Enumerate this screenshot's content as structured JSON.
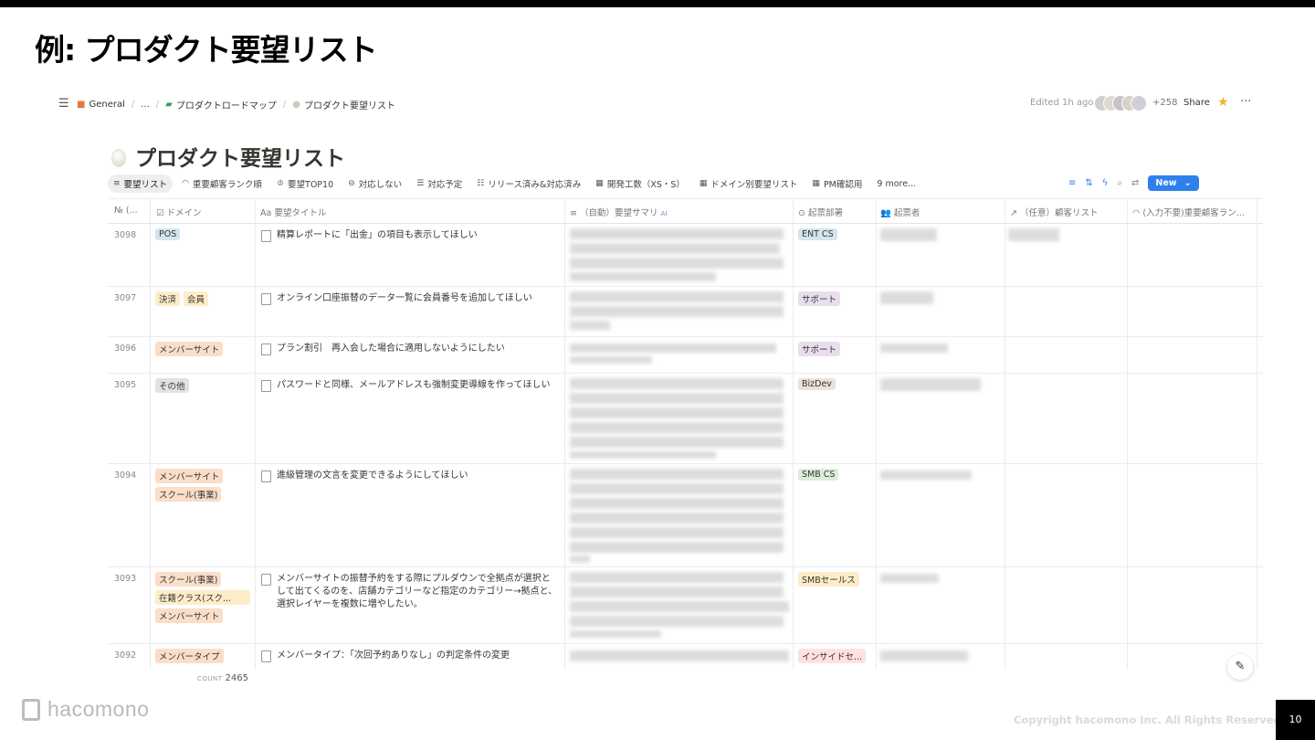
{
  "slide": {
    "title": "例: プロダクト要望リスト",
    "copyright": "Copyright hacomono Inc. All Rights Reserved.",
    "page_number": "10",
    "logo_text": "hacomono"
  },
  "header": {
    "breadcrumbs": [
      "General",
      "...",
      "プロダクトロードマップ",
      "プロダクト要望リスト"
    ],
    "edited": "Edited 1h ago",
    "member_count": "+258",
    "share": "Share"
  },
  "page_title": "プロダクト要望リスト",
  "views": [
    "要望リスト",
    "重要顧客ランク順",
    "要望TOP10",
    "対応しない",
    "対応予定",
    "リリース済み&対応済み",
    "開発工数（XS・S）",
    "ドメイン別要望リスト",
    "PM確認用",
    "9 more..."
  ],
  "new_button": "New",
  "columns": [
    "№ (...",
    "ドメイン",
    "要望タイトル",
    "（自動）要望サマリ",
    "起票部署",
    "起票者",
    "（任意）顧客リスト",
    "(入力不要)重要顧客ラン..."
  ],
  "ai_badge": "AI",
  "rows": [
    {
      "id": "3098",
      "domains": [
        "POS"
      ],
      "title": "精算レポートに「出金」の項目も表示してほしい",
      "dept": "ENT CS"
    },
    {
      "id": "3097",
      "domains": [
        "決済",
        "会員"
      ],
      "title": "オンライン口座振替のデータ一覧に会員番号を追加してほしい",
      "dept": "サポート"
    },
    {
      "id": "3096",
      "domains": [
        "メンバーサイト"
      ],
      "title": "プラン割引　再入会した場合に適用しないようにしたい",
      "dept": "サポート"
    },
    {
      "id": "3095",
      "domains": [
        "その他"
      ],
      "title": "パスワードと同様、メールアドレスも強制変更導線を作ってほしい",
      "dept": "BizDev"
    },
    {
      "id": "3094",
      "domains": [
        "メンバーサイト",
        "スクール(事業)"
      ],
      "title": "進級管理の文言を変更できるようにしてほしい",
      "dept": "SMB CS"
    },
    {
      "id": "3093",
      "domains": [
        "スクール(事業)",
        "在籍クラス(スク...",
        "メンバーサイト"
      ],
      "title": "メンバーサイトの振替予約をする際にプルダウンで全拠点が選択として出てくるのを、店舗カテゴリーなど指定のカテゴリー→拠点と、選択レイヤーを複数に増やしたい。",
      "dept": "SMBセールス"
    },
    {
      "id": "3092",
      "domains": [
        "メンバータイプ"
      ],
      "title": "メンバータイプ：「次回予約ありなし」の判定条件の変更",
      "dept": "インサイドセ..."
    }
  ],
  "count_label": "COUNT",
  "count_value": "2465",
  "colors": {
    "tag_blue": "#d3e5ef",
    "tag_orange": "#fadec9",
    "tag_yellow": "#fdecc8",
    "tag_gray": "#e3e2e0",
    "tag_purple": "#e8deee",
    "tag_brown": "#eee0da",
    "tag_green": "#dbeddb",
    "tag_red": "#ffe2dd",
    "accent": "#2f80ed"
  }
}
